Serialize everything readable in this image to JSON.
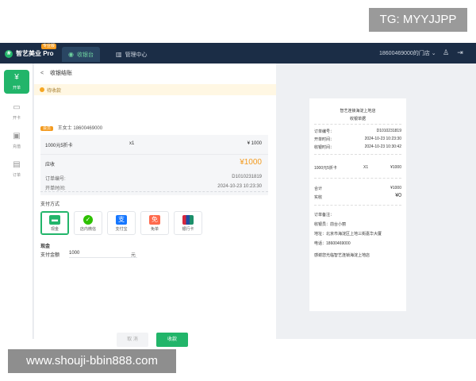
{
  "watermarks": {
    "top": "TG: MYYJJPP",
    "bottom": "www.shouji-bbin888.com"
  },
  "topbar": {
    "brand_name": "智艺美业 Pro",
    "brand_tag": "专业版",
    "tabs": [
      {
        "label": "收银台",
        "icon": "cash-register-icon",
        "active": true
      },
      {
        "label": "管理中心",
        "icon": "chart-icon",
        "active": false
      }
    ],
    "store_name": "18600469000的门店",
    "accent_color": "#22b56a",
    "bar_color": "#1b2d46"
  },
  "sidebar": {
    "items": [
      {
        "label": "开单",
        "icon": "yen-icon",
        "active": true
      },
      {
        "label": "开卡",
        "icon": "card-icon",
        "active": false
      },
      {
        "label": "充值",
        "icon": "wallet-icon",
        "active": false
      },
      {
        "label": "订单",
        "icon": "order-icon",
        "active": false
      }
    ]
  },
  "main": {
    "breadcrumb": "收银结账",
    "notice": "待收款",
    "member": {
      "tag": "会员",
      "name": "王女士",
      "phone": "18600469000"
    },
    "order": {
      "item_name": "1000元5折卡",
      "quantity": "x1",
      "price": "¥ 1000",
      "due_label": "应收",
      "due_amount": "¥1000",
      "order_no_label": "订单编号:",
      "order_no": "D1010231819",
      "time_label": "开单时间:",
      "time": "2024-10-23 10:23:30"
    },
    "payment": {
      "title": "支付方式",
      "options": [
        {
          "label": "现金",
          "icon": "cash-icon",
          "selected": true,
          "color": "#22b56a"
        },
        {
          "label": "店内微信",
          "icon": "wechat-icon",
          "selected": false,
          "color": "#2dc100"
        },
        {
          "label": "支付宝",
          "icon": "alipay-icon",
          "selected": false,
          "color": "#1677ff"
        },
        {
          "label": "免单",
          "icon": "free-icon",
          "selected": false,
          "color": "#ff6a4d"
        },
        {
          "label": "银行卡",
          "icon": "unionpay-icon",
          "selected": false,
          "color": "#d7263d"
        }
      ],
      "cash_title": "现金",
      "amount_label": "支付金额",
      "amount_value": "1000",
      "amount_unit": "元"
    },
    "buttons": {
      "cancel": "取 消",
      "confirm": "收款"
    }
  },
  "receipt": {
    "store": "智艺连锁海淀上地店",
    "title": "收银单据",
    "order_no_label": "订单编号：",
    "order_no": "D1010231819",
    "open_time_label": "开单时间：",
    "open_time": "2024-10-23 10:23:30",
    "pay_time_label": "收银时间：",
    "pay_time": "2024-10-23 10:30:42",
    "item_name": "1000元5折卡",
    "item_qty": "X1",
    "item_price": "¥1000",
    "total_label": "合计",
    "total": "¥1000",
    "paid_label": "实收",
    "paid": "¥0",
    "remark_label": "订单备注：",
    "cashier_label": "收银员：",
    "cashier": "前台小丽",
    "address_label": "地址：",
    "address": "北京市海淀区上地三街嘉华大厦",
    "phone_label": "电话：",
    "phone": "18600469000",
    "footer": "感谢您光临智艺连锁海淀上地店"
  }
}
